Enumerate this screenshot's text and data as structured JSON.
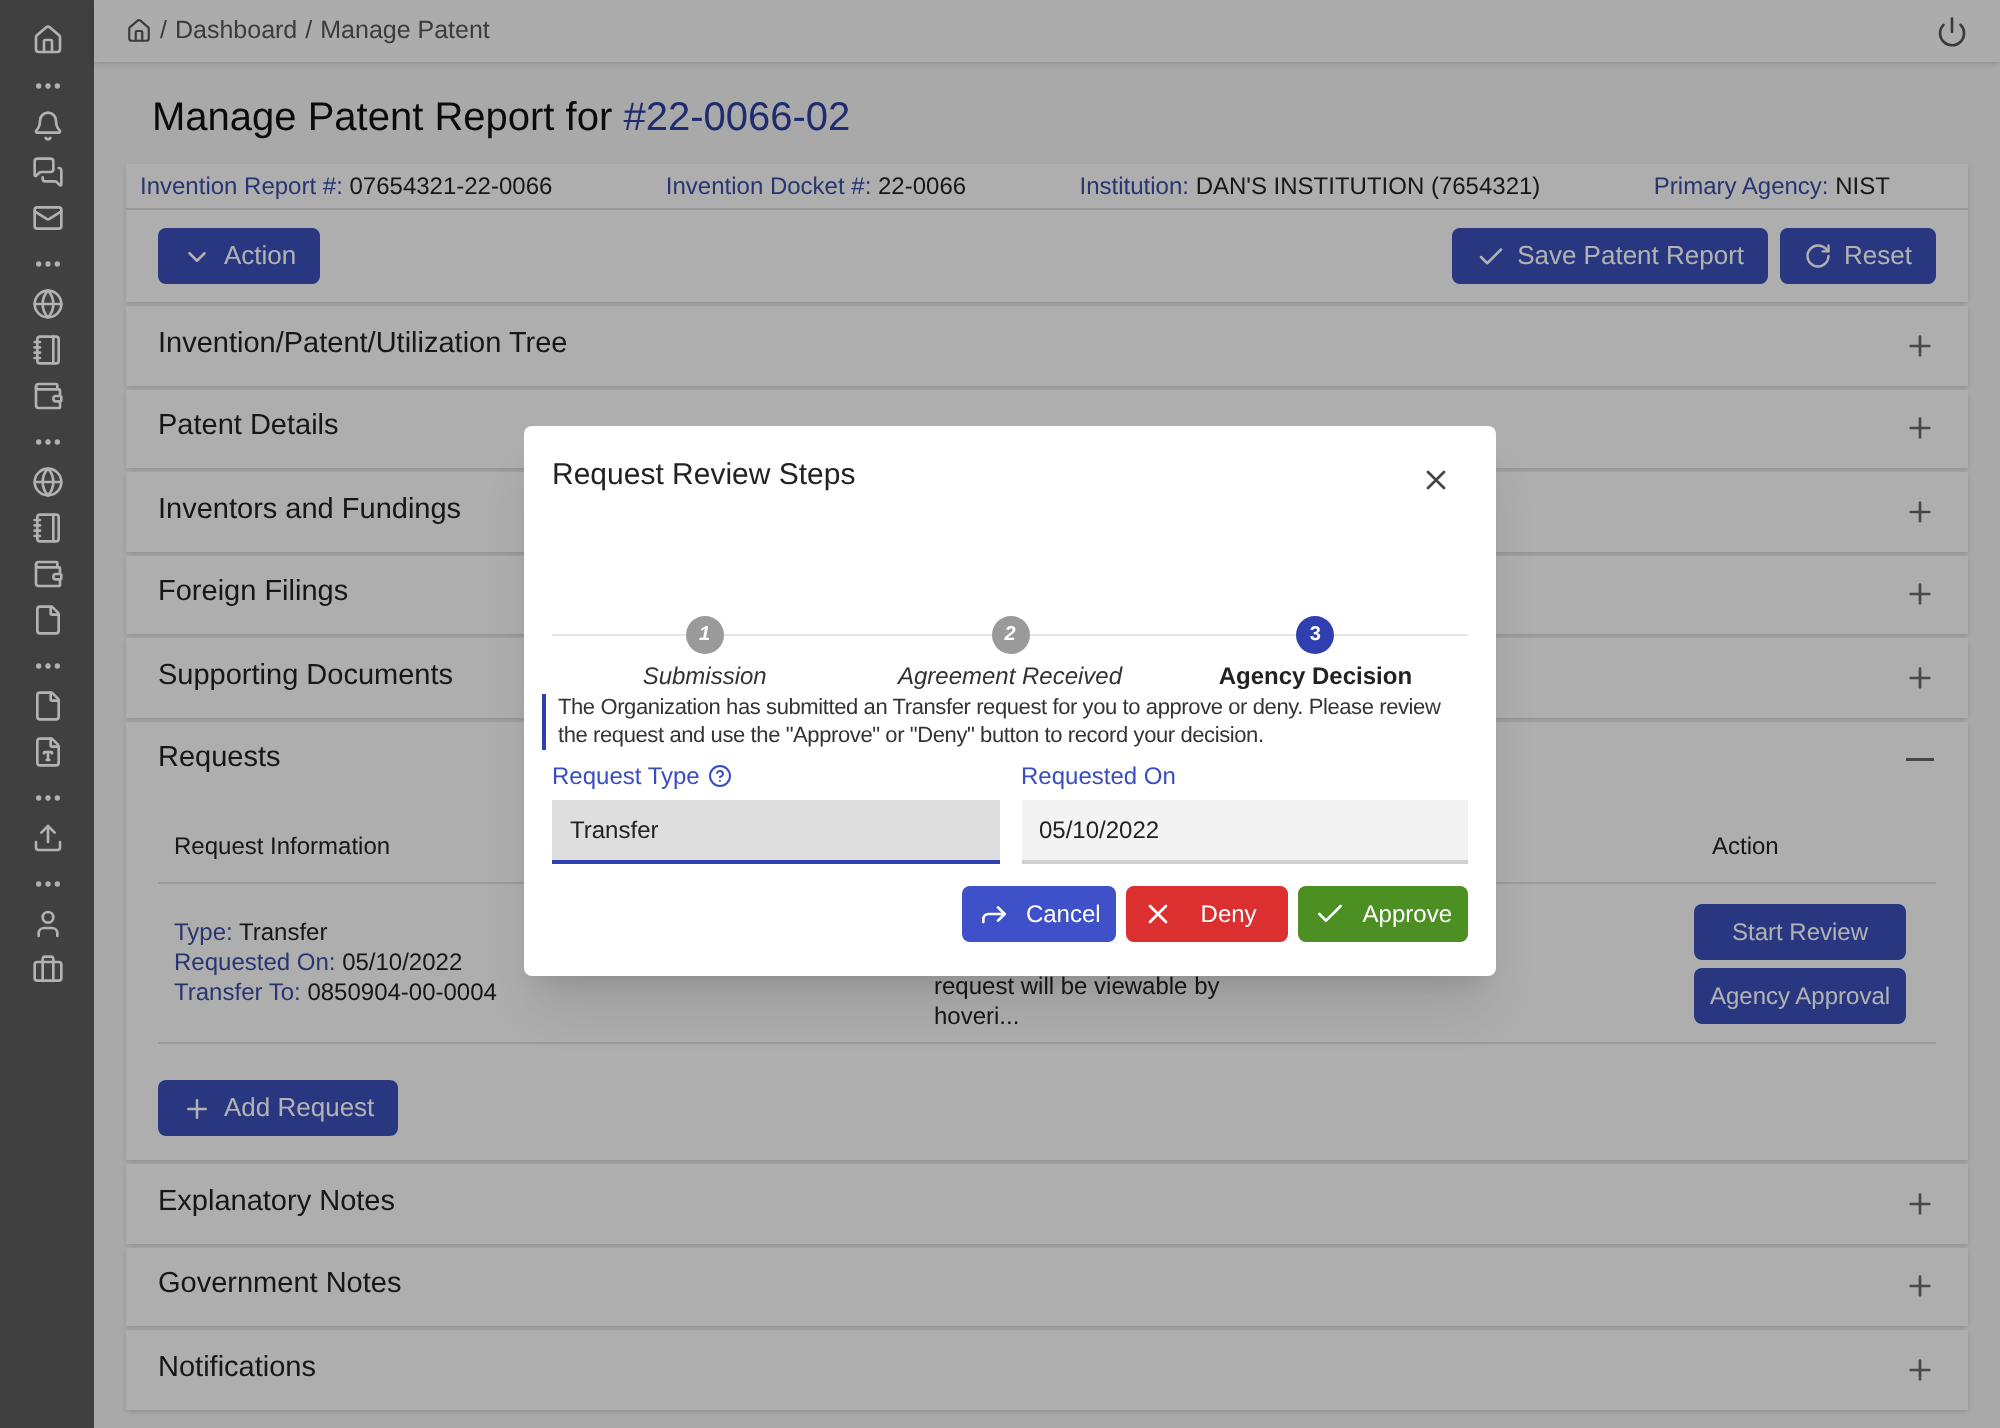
{
  "breadcrumb": {
    "separator": "/",
    "items": [
      "Dashboard",
      "Manage Patent"
    ]
  },
  "title": {
    "prefix": "Manage Patent Report for",
    "number": "#22-0066-02"
  },
  "info": [
    {
      "label": "Invention Report #:",
      "value": "07654321-22-0066"
    },
    {
      "label": "Invention Docket #:",
      "value": "22-0066"
    },
    {
      "label": "Institution:",
      "value": "DAN'S INSTITUTION (7654321)"
    },
    {
      "label": "Primary Agency:",
      "value": "NIST"
    }
  ],
  "toolbar": {
    "action": "Action",
    "save": "Save Patent Report",
    "reset": "Reset"
  },
  "sections": [
    {
      "title": "Invention/Patent/Utilization Tree",
      "expanded": false
    },
    {
      "title": "Patent Details",
      "expanded": false
    },
    {
      "title": "Inventors and Fundings",
      "expanded": false
    },
    {
      "title": "Foreign Filings",
      "expanded": false
    },
    {
      "title": "Supporting Documents",
      "expanded": false
    },
    {
      "title": "Requests",
      "expanded": true
    },
    {
      "title": "Explanatory Notes",
      "expanded": false
    },
    {
      "title": "Government Notes",
      "expanded": false
    },
    {
      "title": "Notifications",
      "expanded": false
    }
  ],
  "requests": {
    "columns": {
      "info": "Request Information",
      "action": "Action"
    },
    "rows": [
      {
        "fields": [
          {
            "label": "Type:",
            "value": "Transfer"
          },
          {
            "label": "Requested On:",
            "value": "05/10/2022"
          },
          {
            "label": "Transfer To:",
            "value": "0850904-00-0004"
          }
        ],
        "note": [
          "request will be viewable by",
          "hoveri..."
        ],
        "actions": [
          "Start Review",
          "Agency Approval"
        ]
      }
    ],
    "add": "Add Request"
  },
  "modal": {
    "title": "Request Review Steps",
    "steps": [
      {
        "number": "1",
        "label": "Submission",
        "active": false
      },
      {
        "number": "2",
        "label": "Agreement Received",
        "active": false
      },
      {
        "number": "3",
        "label": "Agency Decision",
        "active": true
      }
    ],
    "message": "The Organization has submitted an Transfer request for you to approve or deny. Please review the request and use the \"Approve\" or \"Deny\" button to record your decision.",
    "fields": [
      {
        "label": "Request Type",
        "value": "Transfer",
        "help": true,
        "disabled": true
      },
      {
        "label": "Requested On",
        "value": "05/10/2022",
        "help": false,
        "disabled": false
      }
    ],
    "buttons": [
      {
        "kind": "cancel",
        "label": "Cancel"
      },
      {
        "kind": "deny",
        "label": "Deny"
      },
      {
        "kind": "approve",
        "label": "Approve"
      }
    ]
  }
}
